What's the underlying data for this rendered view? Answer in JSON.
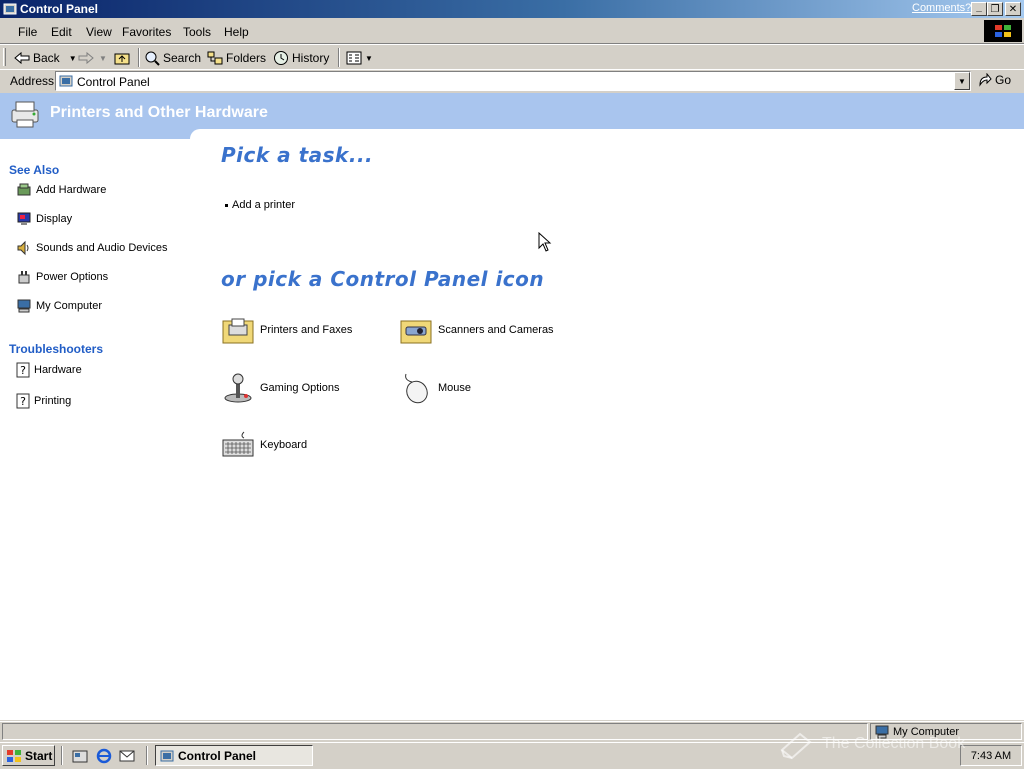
{
  "window": {
    "title": "Control Panel",
    "comments_link": "Comments?",
    "minimize": "_",
    "maximize": "❐",
    "close": "✕"
  },
  "menu": [
    "File",
    "Edit",
    "View",
    "Favorites",
    "Tools",
    "Help"
  ],
  "toolbar": {
    "back": "Back",
    "search": "Search",
    "folders": "Folders",
    "history": "History"
  },
  "address": {
    "label": "Address",
    "value": "Control Panel",
    "go": "Go"
  },
  "header": {
    "title": "Printers and Other Hardware"
  },
  "sidebar": {
    "see_also_title": "See Also",
    "see_also": [
      "Add Hardware",
      "Display",
      "Sounds and Audio Devices",
      "Power Options",
      "My Computer"
    ],
    "troubleshooters_title": "Troubleshooters",
    "troubleshooters": [
      "Hardware",
      "Printing"
    ]
  },
  "main": {
    "task_title": "Pick a task...",
    "tasks": [
      "Add a printer"
    ],
    "icon_title": "or pick a Control Panel icon",
    "icons": [
      "Printers and Faxes",
      "Scanners and Cameras",
      "Gaming Options",
      "Mouse",
      "Keyboard"
    ]
  },
  "status": {
    "zone": "My Computer"
  },
  "taskbar": {
    "start": "Start",
    "task": "Control Panel",
    "clock": "7:43 AM",
    "watermark": "The Collection Book"
  }
}
